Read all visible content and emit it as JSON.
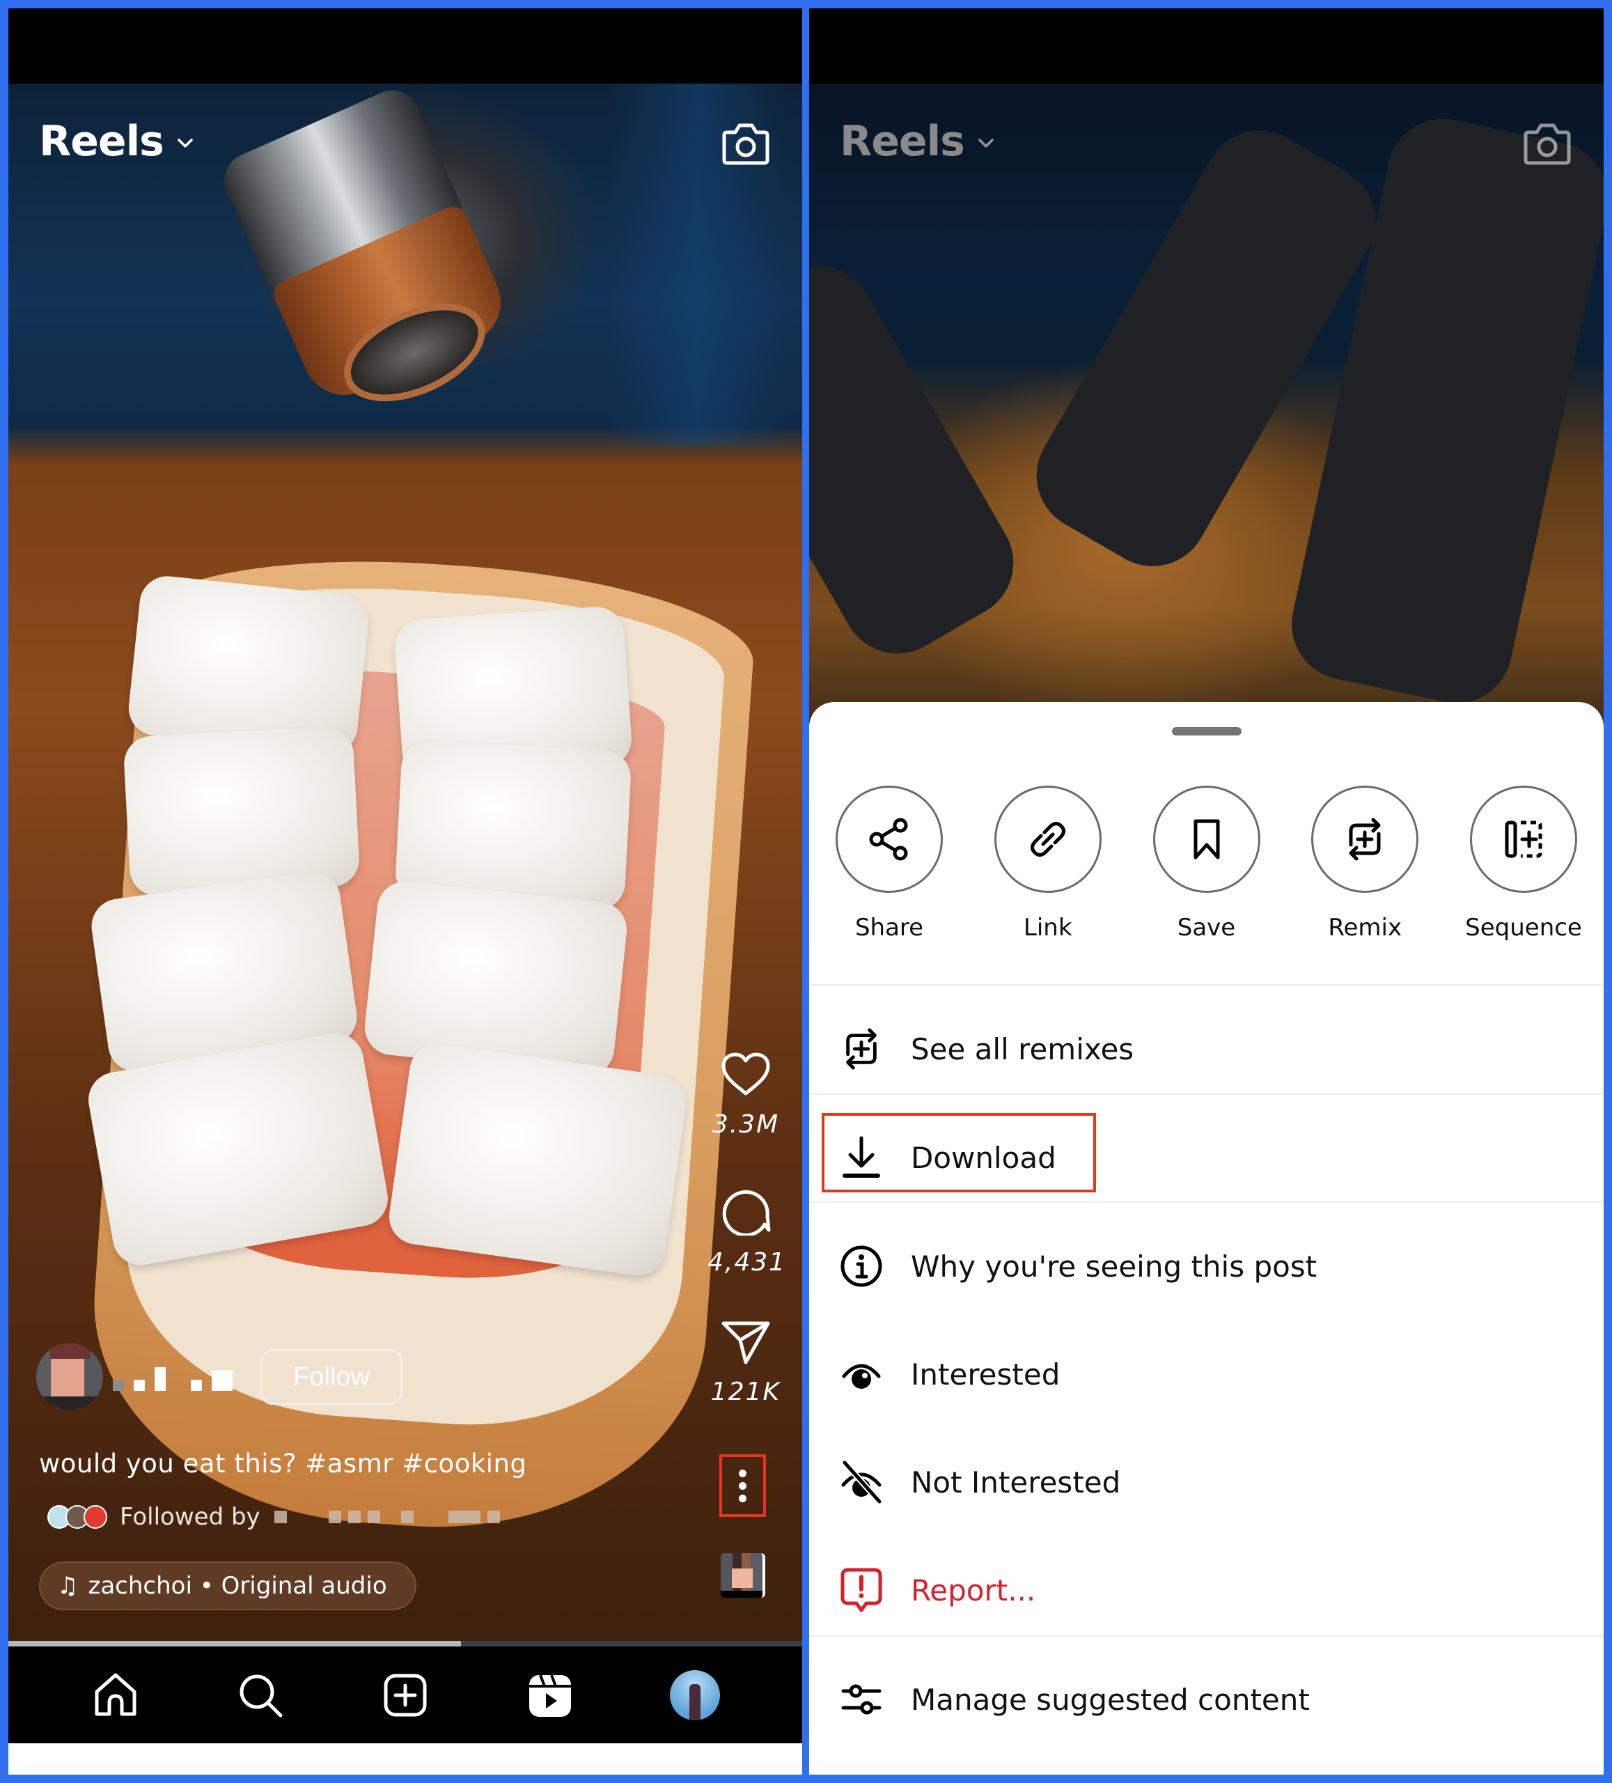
{
  "colors": {
    "frame_border": "#2F6FF0",
    "highlight": "#E03A1E",
    "danger": "#D3222A",
    "sheet_bg": "#FFFFFF"
  },
  "left": {
    "header": {
      "title": "Reels",
      "title_icon": "chevron-down-icon",
      "camera_icon": "camera-icon"
    },
    "side_actions": [
      {
        "icon": "heart-icon",
        "count": "3.3M"
      },
      {
        "icon": "comment-icon",
        "count": "4,431"
      },
      {
        "icon": "send-icon",
        "count": "121K"
      }
    ],
    "more_icon": "more-vertical-icon",
    "author": {
      "follow_label": "Follow"
    },
    "caption": "would you eat this? #asmr #cooking",
    "followed_by_label": "Followed by",
    "audio": {
      "icon": "music-note-icon",
      "text": "zachchoi • Original audio"
    },
    "progress": 0.57,
    "bottom_nav": [
      {
        "name": "home",
        "icon": "home-icon"
      },
      {
        "name": "search",
        "icon": "search-icon"
      },
      {
        "name": "create",
        "icon": "plus-square-icon"
      },
      {
        "name": "reels",
        "icon": "reels-icon"
      },
      {
        "name": "profile",
        "icon": "avatar"
      }
    ]
  },
  "right": {
    "header": {
      "title": "Reels",
      "title_icon": "chevron-down-icon",
      "camera_icon": "camera-icon"
    },
    "sheet": {
      "actions": [
        {
          "label": "Share",
          "icon": "share-icon"
        },
        {
          "label": "Link",
          "icon": "link-icon"
        },
        {
          "label": "Save",
          "icon": "bookmark-icon"
        },
        {
          "label": "Remix",
          "icon": "remix-icon"
        },
        {
          "label": "Sequence",
          "icon": "sequence-icon"
        }
      ],
      "menu": [
        {
          "label": "See all remixes",
          "icon": "remix-icon"
        },
        {
          "label": "Download",
          "icon": "download-icon",
          "highlighted": true
        },
        {
          "label": "Why you're seeing this post",
          "icon": "info-icon"
        },
        {
          "label": "Interested",
          "icon": "eye-icon"
        },
        {
          "label": "Not Interested",
          "icon": "eye-off-icon"
        },
        {
          "label": "Report...",
          "icon": "report-icon",
          "danger": true
        },
        {
          "label": "Manage suggested content",
          "icon": "sliders-icon"
        }
      ]
    }
  }
}
